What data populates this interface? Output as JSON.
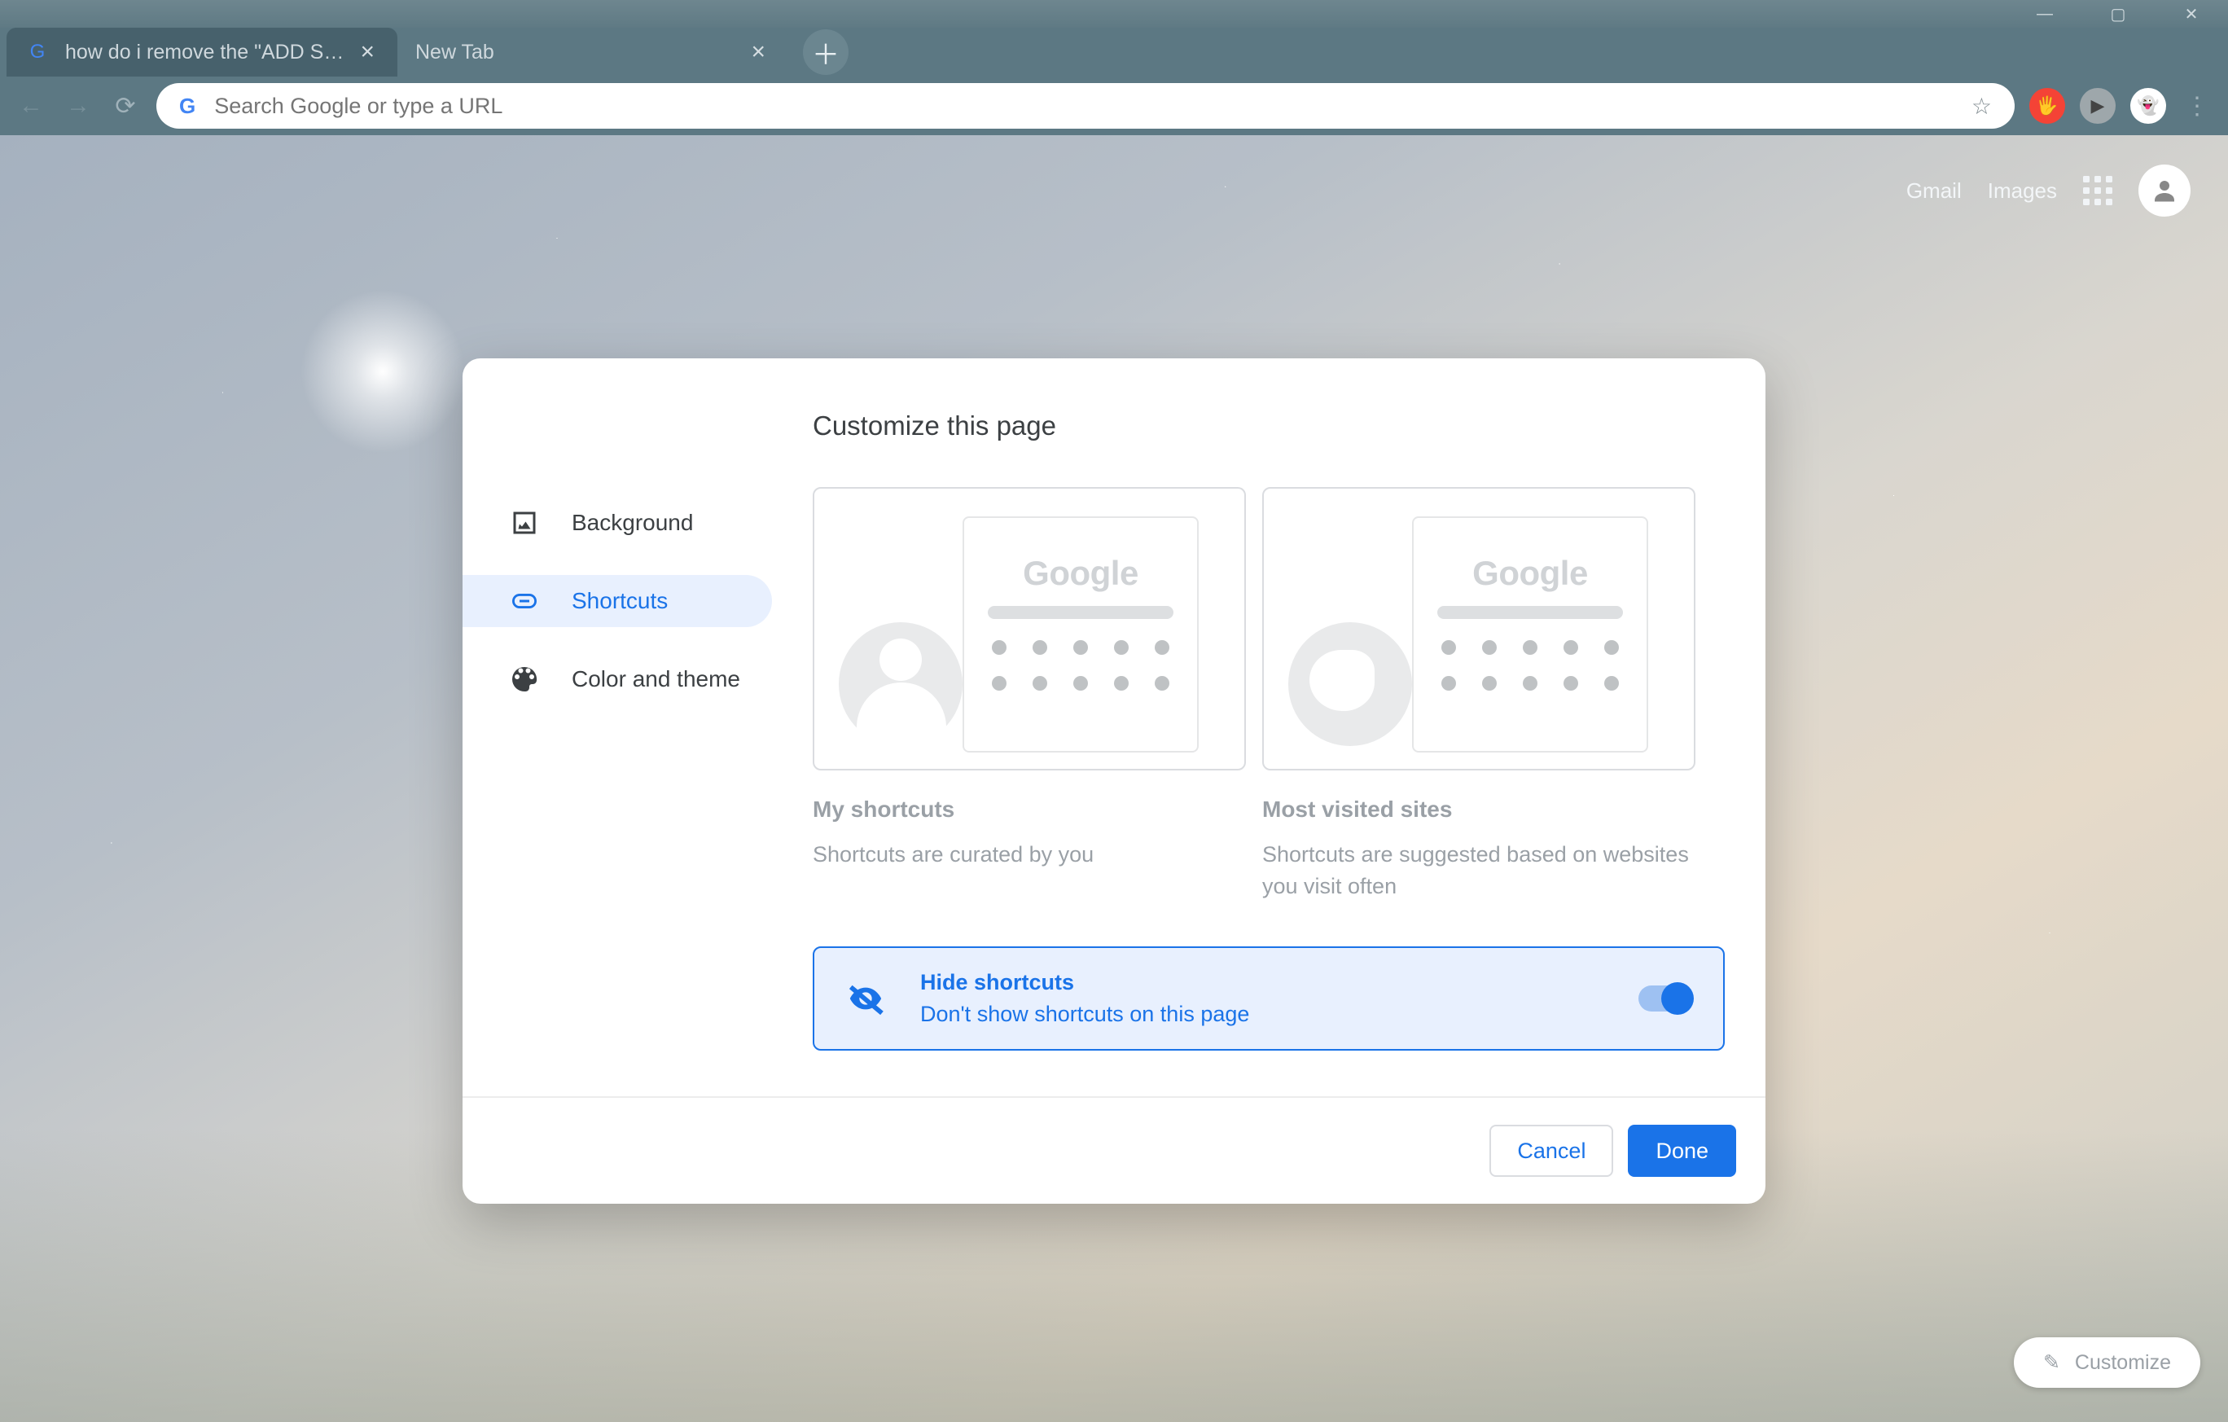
{
  "window": {
    "buttons": {
      "min": "—",
      "max": "▢",
      "close": "✕"
    }
  },
  "tabs": [
    {
      "title": "how do i remove the \"ADD SHOR…",
      "active": false
    },
    {
      "title": "New Tab",
      "active": true
    }
  ],
  "new_tab_glyph": "＋",
  "toolbar": {
    "back": "←",
    "forward": "→",
    "reload": "⟳",
    "omnibox_placeholder": "Search Google or type a URL",
    "bookmark_star": "☆"
  },
  "extensions": {
    "adblock": "🖐",
    "play": "▶",
    "ghost": "👻"
  },
  "ntp_header": {
    "gmail": "Gmail",
    "images": "Images"
  },
  "customize_pill": {
    "label": "Customize",
    "pencil": "✎"
  },
  "dialog": {
    "title": "Customize this page",
    "sidebar": {
      "background": "Background",
      "shortcuts": "Shortcuts",
      "color_theme": "Color and theme"
    },
    "cards": {
      "my": {
        "title": "My shortcuts",
        "desc": "Shortcuts are curated by you",
        "glogo": "Google"
      },
      "visited": {
        "title": "Most visited sites",
        "desc": "Shortcuts are suggested based on websites you visit often",
        "glogo": "Google"
      }
    },
    "hide": {
      "title": "Hide shortcuts",
      "desc": "Don't show shortcuts on this page",
      "enabled": true
    },
    "footer": {
      "cancel": "Cancel",
      "done": "Done"
    }
  }
}
